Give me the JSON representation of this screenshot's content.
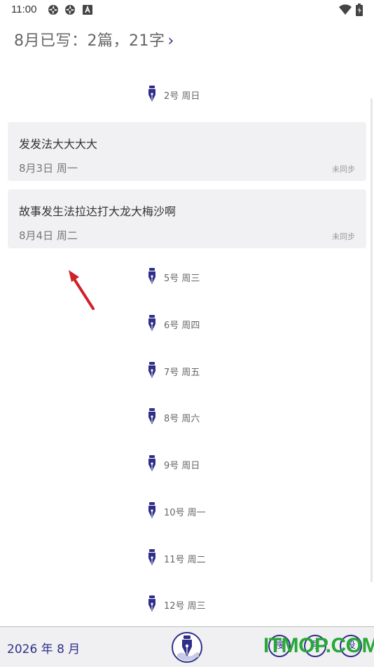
{
  "status_bar": {
    "time": "11:00"
  },
  "summary": {
    "text": "8月已写：2篇，21字",
    "chevron": "›"
  },
  "days_top": [
    {
      "label": "2号 周日"
    }
  ],
  "entries": [
    {
      "title": "发发法大大大大",
      "date": "8月3日  周一",
      "sync": "未同步"
    },
    {
      "title": "故事发生法拉达打大龙大梅沙啊",
      "date": "8月4日  周二",
      "sync": "未同步"
    }
  ],
  "days": [
    {
      "label": "5号 周三"
    },
    {
      "label": "6号 周四"
    },
    {
      "label": "7号 周五"
    },
    {
      "label": "8号 周六"
    },
    {
      "label": "9号 周日"
    },
    {
      "label": "10号 周一"
    },
    {
      "label": "11号 周二"
    },
    {
      "label": "12号 周三"
    }
  ],
  "bottom": {
    "month": "2026 年 8 月",
    "buttons": [
      {
        "label": "搜"
      },
      {
        "label": "写"
      },
      {
        "label": "设"
      }
    ]
  },
  "watermark": "ITMOP.COM",
  "colors": {
    "accent": "#2f2f8a",
    "card": "#f1f1f4",
    "watermark": "#28a838",
    "arrow": "#d0202a"
  },
  "icons": [
    "aperture-icon",
    "aperture-icon",
    "a-box-icon",
    "wifi-icon",
    "battery-icon",
    "fountain-pen-icon",
    "app-logo-icon",
    "chevron-right-icon"
  ]
}
